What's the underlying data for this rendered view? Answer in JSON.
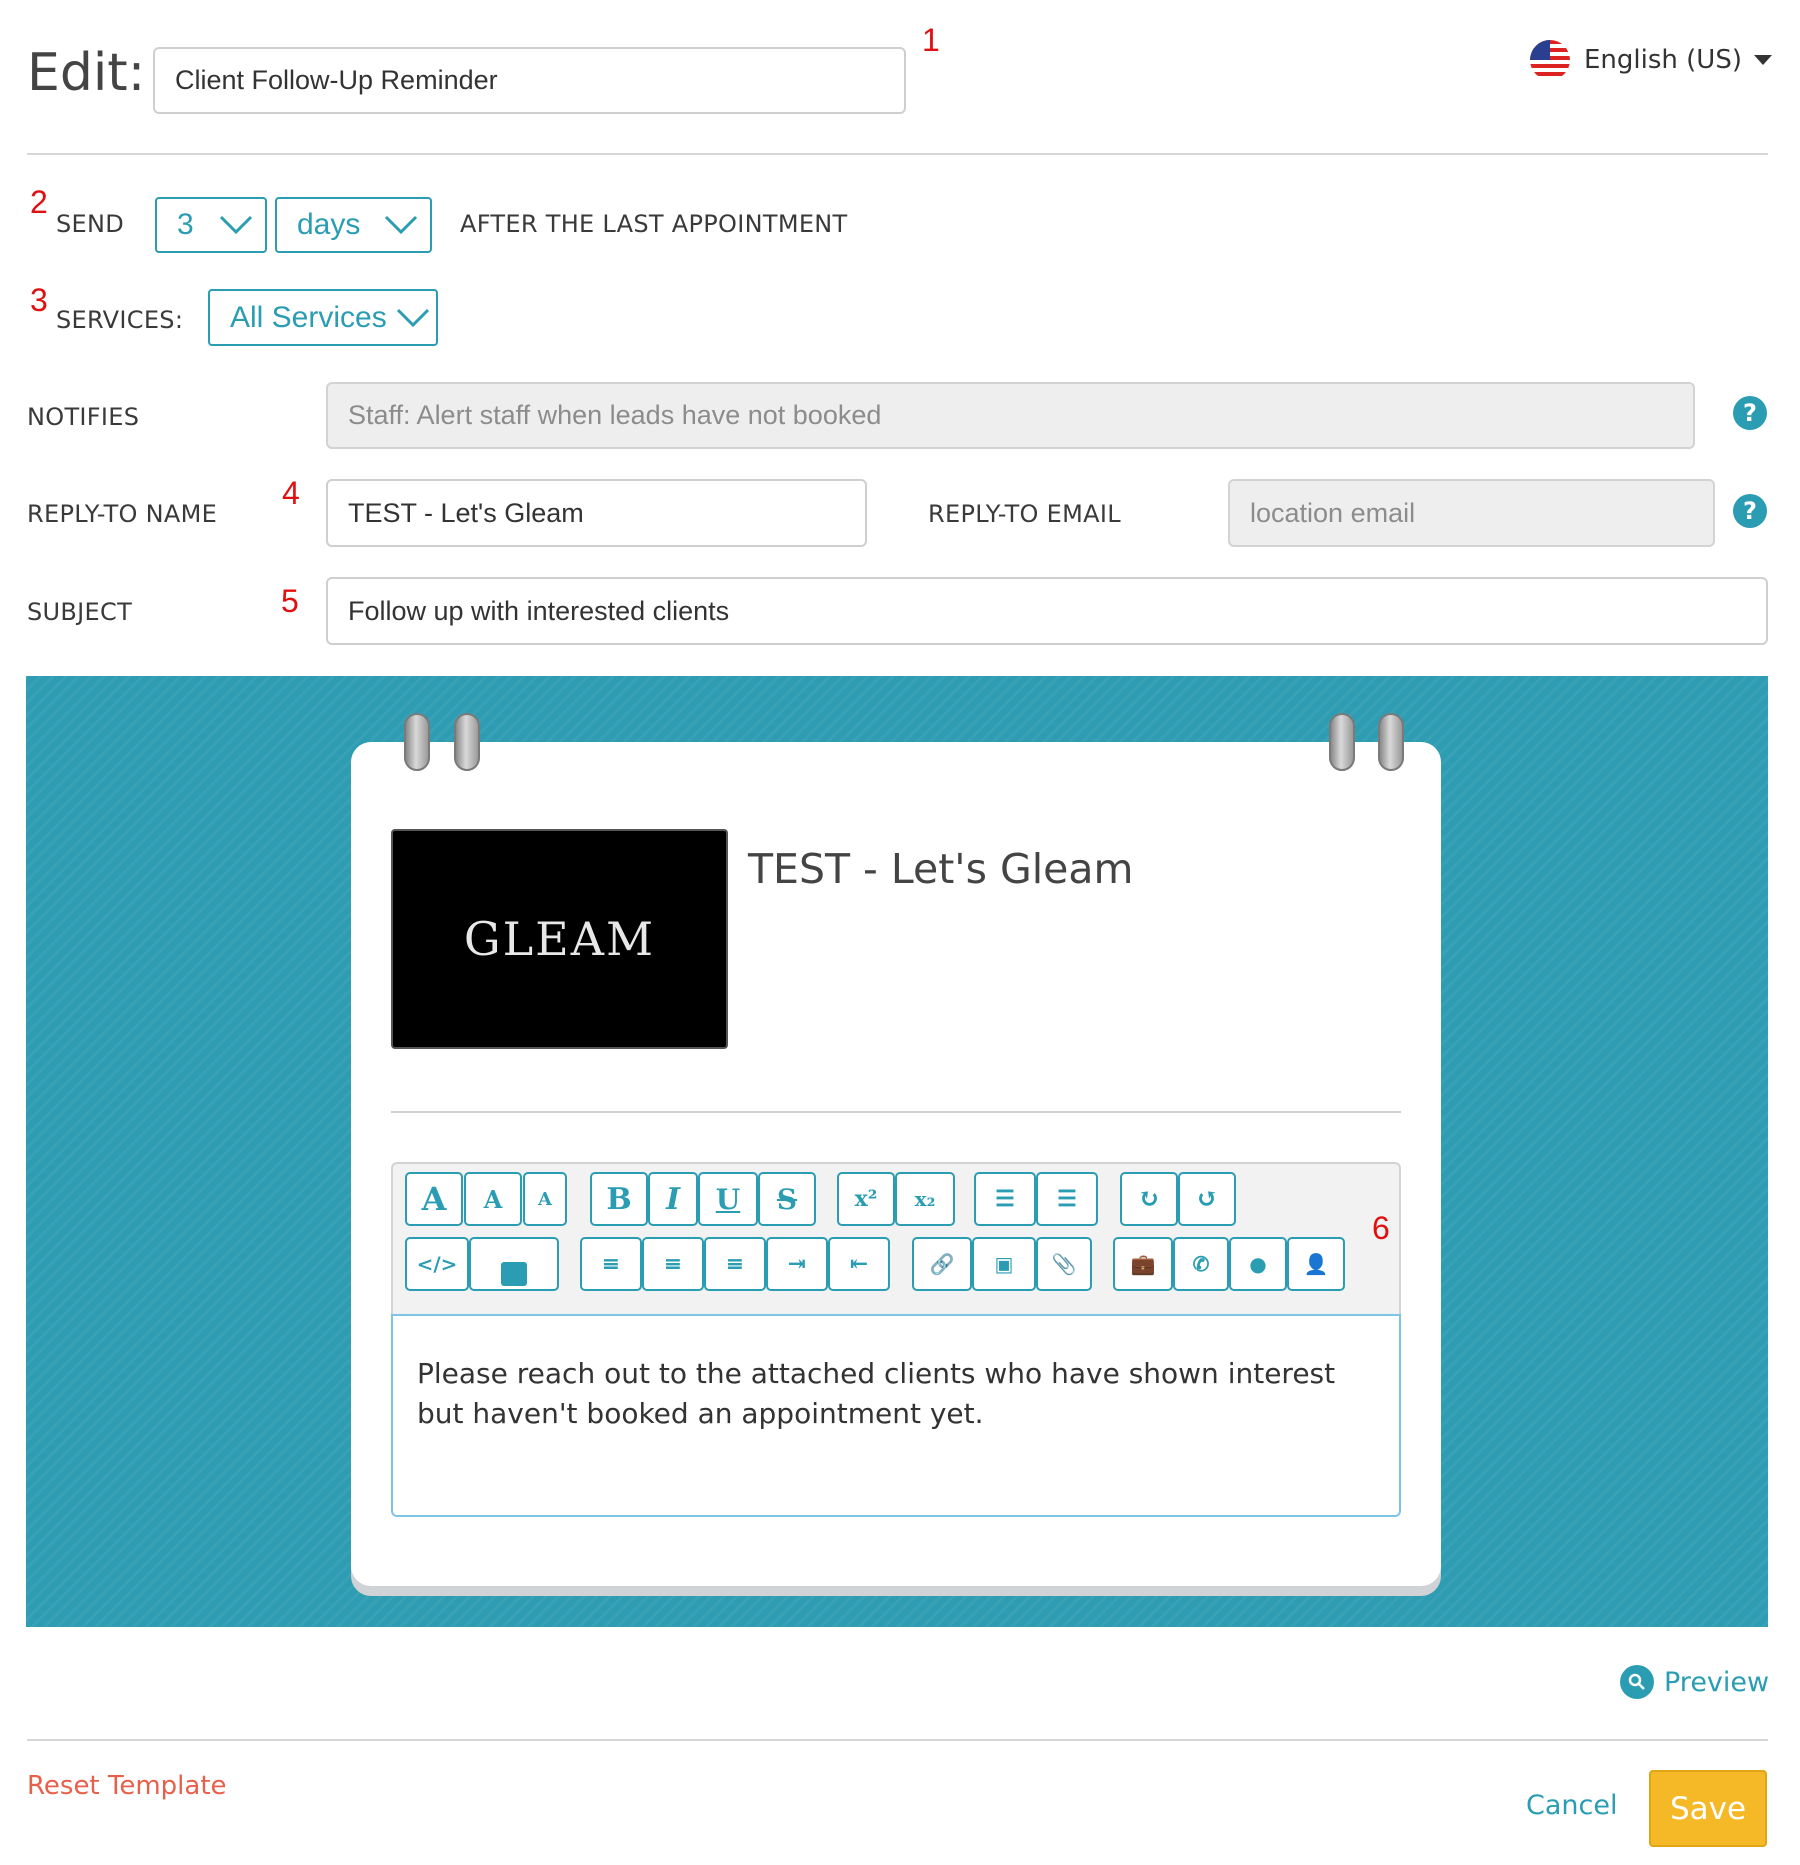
{
  "header": {
    "title": "Edit:",
    "template_name": "Client Follow-Up Reminder",
    "language": "English (US)",
    "language_icon": "us-flag-icon"
  },
  "markers": [
    "1",
    "2",
    "3",
    "4",
    "5",
    "6"
  ],
  "send": {
    "label": "SEND",
    "amount": "3",
    "unit": "days",
    "suffix": "AFTER THE LAST APPOINTMENT"
  },
  "services": {
    "label": "SERVICES:",
    "value": "All Services"
  },
  "notifies": {
    "label": "NOTIFIES",
    "value": "Staff: Alert staff when leads have not booked"
  },
  "reply_to": {
    "name_label": "REPLY-TO NAME",
    "name_value": "TEST - Let's Gleam",
    "email_label": "REPLY-TO EMAIL",
    "email_placeholder": "location email"
  },
  "subject": {
    "label": "SUBJECT",
    "value": "Follow up with interested clients"
  },
  "email_preview": {
    "business_name": "TEST - Let's Gleam",
    "logo_text": "GLEAM",
    "body": "Please reach out to the attached clients who have shown interest but haven't booked an appointment yet."
  },
  "toolbar": {
    "row1": [
      [
        "font-large-icon",
        "A"
      ],
      [
        "font-medium-icon",
        "A"
      ],
      [
        "font-small-icon",
        "A"
      ],
      [
        "bold-icon",
        "B"
      ],
      [
        "italic-icon",
        "I"
      ],
      [
        "underline-icon",
        "U"
      ],
      [
        "strikethrough-icon",
        "S"
      ],
      [
        "superscript-icon",
        "x²"
      ],
      [
        "subscript-icon",
        "x₂"
      ],
      [
        "bulleted-list-icon",
        "☰"
      ],
      [
        "numbered-list-icon",
        "☰"
      ],
      [
        "redo-icon",
        "↻"
      ],
      [
        "undo-icon",
        "↺"
      ]
    ],
    "row2": [
      [
        "code-icon",
        "</>"
      ],
      [
        "text-color-icon",
        "■"
      ],
      [
        "align-left-icon",
        "≡"
      ],
      [
        "align-center-icon",
        "≡"
      ],
      [
        "align-right-icon",
        "≡"
      ],
      [
        "indent-icon",
        "⇥"
      ],
      [
        "outdent-icon",
        "⇤"
      ],
      [
        "link-icon",
        "🔗"
      ],
      [
        "image-icon",
        "▣"
      ],
      [
        "attachment-icon",
        "📎"
      ],
      [
        "business-icon",
        "💼"
      ],
      [
        "phone-icon",
        "✆"
      ],
      [
        "globe-icon",
        "●"
      ],
      [
        "person-icon",
        "👤"
      ]
    ]
  },
  "actions": {
    "preview": "Preview",
    "reset": "Reset Template",
    "cancel": "Cancel",
    "save": "Save"
  },
  "colors": {
    "accent": "#2b9db3",
    "stage_bg": "#2e9cb2",
    "save": "#f5b928",
    "reset": "#e8604c",
    "marker": "#e01010"
  }
}
